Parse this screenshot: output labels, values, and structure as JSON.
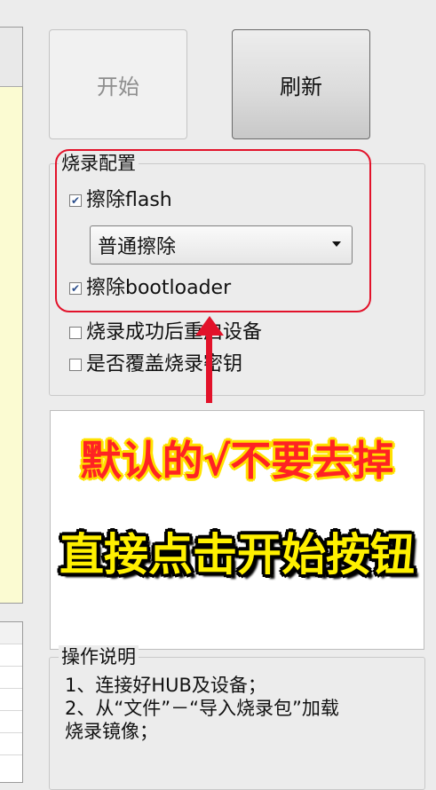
{
  "buttons": {
    "start": "开始",
    "refresh": "刷新"
  },
  "config": {
    "title": "烧录配置",
    "erase_flash": {
      "label": "擦除flash",
      "checked": true
    },
    "erase_mode": {
      "selected": "普通擦除"
    },
    "erase_bootloader": {
      "label": "擦除bootloader",
      "checked": true
    },
    "reboot_after": {
      "label": "烧录成功后重启设备",
      "checked": false
    },
    "overwrite_key": {
      "label": "是否覆盖烧录密钥",
      "checked": false
    }
  },
  "banner": {
    "line1": "默认的√不要去掉",
    "line2": "直接点击开始按钮"
  },
  "help": {
    "title": "操作说明",
    "lines": [
      "1、连接好HUB及设备；",
      "2、从“文件”－“导入烧录包”加载",
      "烧录镜像；"
    ]
  },
  "colors": {
    "annotation_red": "#e2122a",
    "banner_red": "#ff2323",
    "banner_yellow": "#fff000"
  },
  "icons": {
    "annotation": "up-arrow-icon",
    "dropdown": "chevron-down-icon"
  }
}
